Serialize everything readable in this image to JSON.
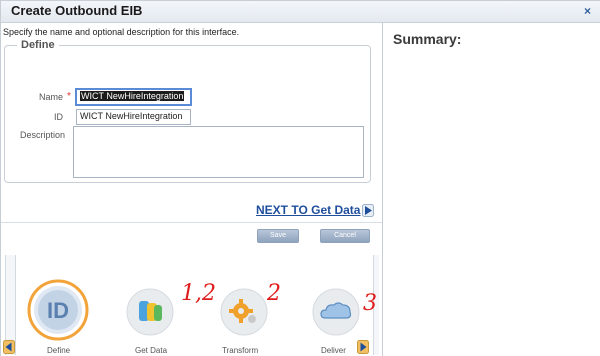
{
  "window": {
    "title": "Create Outbound EIB",
    "close_glyph": "×"
  },
  "form": {
    "instruction": "Specify the name and optional description for this interface.",
    "section_title": "Define",
    "name_label": "Name",
    "name_required": "*",
    "name_value": "WICT NewHireIntegration",
    "id_label": "ID",
    "id_value": "WICT NewHireIntegration",
    "description_label": "Description",
    "description_value": ""
  },
  "actions": {
    "next_label": "NEXT TO Get Data",
    "save_label": "Save",
    "cancel_label": "Cancel"
  },
  "wizard": {
    "steps": [
      {
        "label": "Define",
        "icon": "id-icon",
        "active": true
      },
      {
        "label": "Get Data",
        "icon": "data-icon",
        "active": false
      },
      {
        "label": "Transform",
        "icon": "gear-icon",
        "active": false
      },
      {
        "label": "Deliver",
        "icon": "cloud-icon",
        "active": false
      }
    ]
  },
  "summary": {
    "title": "Summary:"
  },
  "annotations": [
    "1,2",
    "2",
    "3"
  ],
  "colors": {
    "link": "#1f4e9c",
    "annotation": "#e01b1b",
    "active_ring": "#f2a33a",
    "button": "#8fa3bd"
  }
}
